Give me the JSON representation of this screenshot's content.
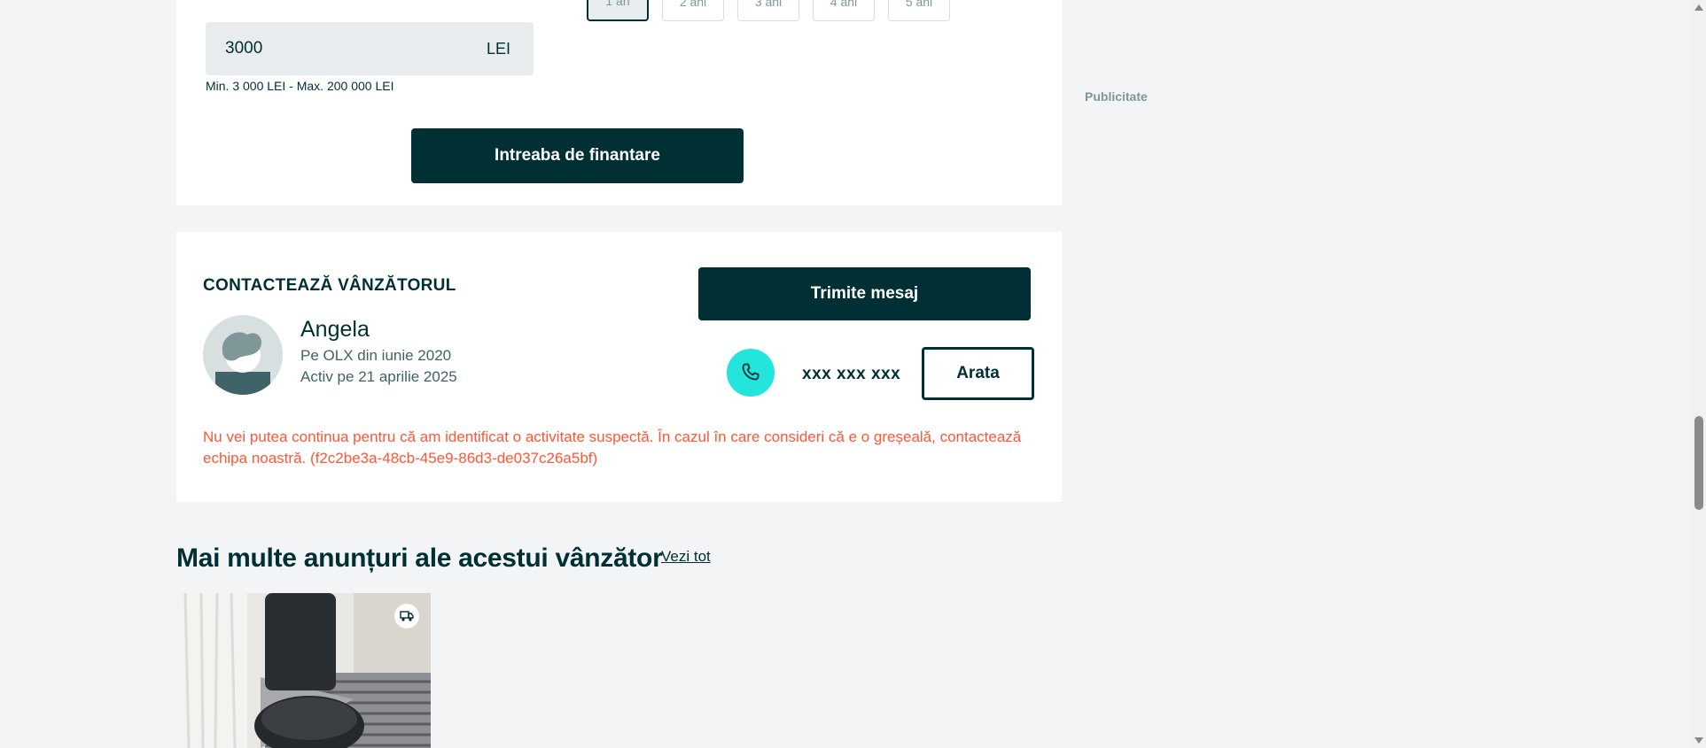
{
  "financing": {
    "terms": [
      "1 an",
      "2 ani",
      "3 ani",
      "4 ani",
      "5 ani"
    ],
    "selected_term": "1 an",
    "amount_value": "3000",
    "amount_unit": "LEI",
    "amount_hint": "Min. 3 000 LEI - Max. 200 000 LEI",
    "button_label": "Intreaba de finantare"
  },
  "ad_slot": {
    "label": "Publicitate"
  },
  "contact": {
    "title": "CONTACTEAZĂ VÂNZĂTORUL",
    "seller_name": "Angela",
    "member_since": "Pe OLX din iunie 2020",
    "last_active": "Activ pe 21 aprilie 2025",
    "message_button": "Trimite mesaj",
    "phone_masked": "xxx xxx xxx",
    "show_button": "Arata",
    "error_message": "Nu vei putea continua pentru că am identificat o activitate suspectă. În cazul în care consideri că e o greșeală, contactează echipa noastră. (f2c2be3a-48cb-45e9-86d3-de037c26a5bf)"
  },
  "more_ads": {
    "title": "Mai multe anunțuri ale acestui vânzător",
    "see_all": "Vezi tot"
  },
  "icons": {
    "phone": "phone-icon",
    "delivery": "delivery-truck-icon",
    "avatar": "user-avatar-placeholder"
  },
  "colors": {
    "primary_dark": "#002f34",
    "accent_teal": "#23e5db",
    "error": "#ff5636",
    "background": "#f2f4f5"
  }
}
